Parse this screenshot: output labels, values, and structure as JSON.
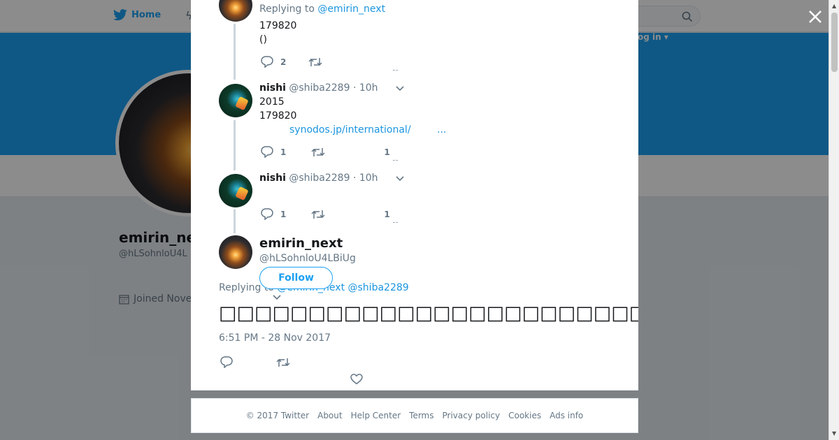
{
  "nav": {
    "home_label": "Home",
    "login_label": "og in ▾"
  },
  "profile_bg": {
    "name": "emirin_ne",
    "handle": "@hLSohnloU4L",
    "joined": "Joined Nove"
  },
  "thread": [
    {
      "replying_prefix": "Replying to",
      "replying_to": "@emirin_next",
      "lines": [
        "179820",
        "()"
      ],
      "reply_count": "2",
      "retweet_count": "",
      "like_count": ""
    },
    {
      "name": "nishi",
      "handle": "@shiba2289",
      "time": "· 10h",
      "lines": [
        "2015",
        "179820"
      ],
      "link_text": "synodos.jp/international/",
      "link_more": "...",
      "reply_count": "1",
      "retweet_count": "",
      "like_count": "1"
    },
    {
      "name": "nishi",
      "handle": "@shiba2289",
      "time": "· 10h",
      "lines": [],
      "reply_count": "1",
      "retweet_count": "",
      "like_count": "1"
    }
  ],
  "main_tweet": {
    "name": "emirin_next",
    "handle": "@hLSohnloU4LBiUg",
    "follow_label": "Follow",
    "replying_prefix": "Replying to",
    "replying_to": "@emirin_next @shiba2289",
    "text": "□□□□□□□□□□□□□□□□□□□□□□□□□□□□□□□□□□□□□□□□□□",
    "timestamp": "6:51 PM - 28 Nov 2017"
  },
  "footer": {
    "links": [
      "© 2017 Twitter",
      "About",
      "Help Center",
      "Terms",
      "Privacy policy",
      "Cookies",
      "Ads info"
    ]
  },
  "colors": {
    "brand": "#1da1f2",
    "link": "#1b95e0",
    "muted": "#657786",
    "text": "#14171a"
  },
  "icons": {
    "twitter_bird": "twitter-bird-icon",
    "reply": "reply-icon",
    "retweet": "retweet-icon",
    "like": "heart-icon",
    "close": "close-icon",
    "search": "search-icon",
    "caret": "chevron-down-icon"
  }
}
